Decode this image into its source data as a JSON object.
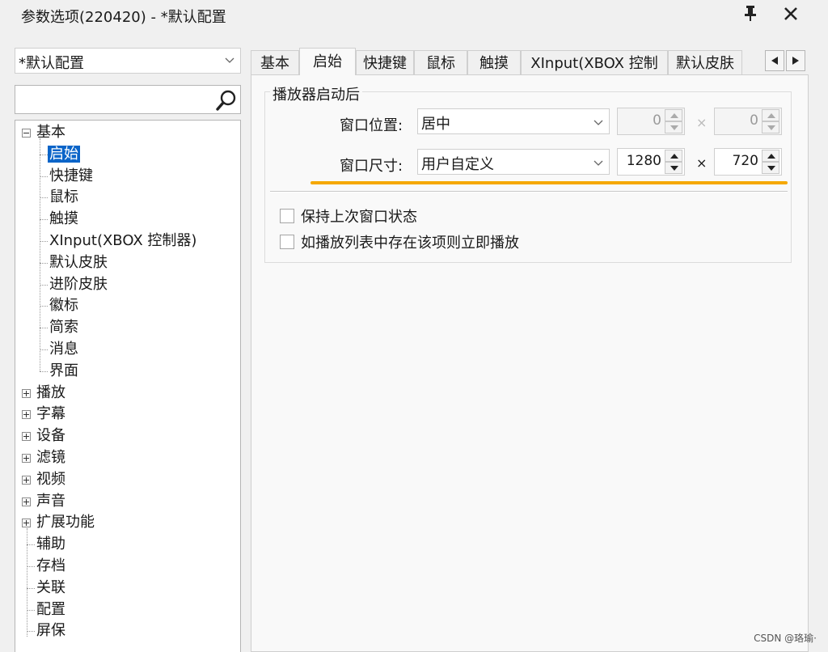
{
  "window": {
    "title": "参数选项(220420) - *默认配置",
    "pin_icon": "pin-icon",
    "close_icon": "close-icon"
  },
  "left": {
    "profile": "*默认配置",
    "search_placeholder": ""
  },
  "tree": {
    "items": [
      {
        "label": "基本",
        "level": 0,
        "expander": "minus"
      },
      {
        "label": "启始",
        "level": 1,
        "selected": true
      },
      {
        "label": "快捷键",
        "level": 1
      },
      {
        "label": "鼠标",
        "level": 1
      },
      {
        "label": "触摸",
        "level": 1
      },
      {
        "label": "XInput(XBOX 控制器)",
        "level": 1
      },
      {
        "label": "默认皮肤",
        "level": 1
      },
      {
        "label": "进阶皮肤",
        "level": 1
      },
      {
        "label": "徽标",
        "level": 1
      },
      {
        "label": "简索",
        "level": 1
      },
      {
        "label": "消息",
        "level": 1
      },
      {
        "label": "界面",
        "level": 1
      },
      {
        "label": "播放",
        "level": 0,
        "expander": "plus"
      },
      {
        "label": "字幕",
        "level": 0,
        "expander": "plus"
      },
      {
        "label": "设备",
        "level": 0,
        "expander": "plus"
      },
      {
        "label": "滤镜",
        "level": 0,
        "expander": "plus"
      },
      {
        "label": "视频",
        "level": 0,
        "expander": "plus"
      },
      {
        "label": "声音",
        "level": 0,
        "expander": "plus"
      },
      {
        "label": "扩展功能",
        "level": 0,
        "expander": "plus"
      },
      {
        "label": "辅助",
        "level": 0
      },
      {
        "label": "存档",
        "level": 0
      },
      {
        "label": "关联",
        "level": 0
      },
      {
        "label": "配置",
        "level": 0
      },
      {
        "label": "屏保",
        "level": 0
      }
    ]
  },
  "tabs": {
    "items": [
      "基本",
      "启始",
      "快捷键",
      "鼠标",
      "触摸",
      "XInput(XBOX 控制器)",
      "默认皮肤"
    ],
    "active": "启始",
    "scroll_left_icon": "triangle-left-icon",
    "scroll_right_icon": "triangle-right-icon"
  },
  "startup": {
    "group_title": "播放器启动后",
    "position": {
      "label": "窗口位置:",
      "mode": "居中",
      "x": "0",
      "sep": "×",
      "y": "0"
    },
    "size": {
      "label": "窗口尺寸:",
      "mode": "用户自定义",
      "w": "1280",
      "sep": "×",
      "h": "720"
    },
    "checkboxes": [
      {
        "label": "保持上次窗口状态",
        "checked": false
      },
      {
        "label": "如播放列表中存在该项则立即播放",
        "checked": false
      }
    ]
  },
  "colors": {
    "selection": "#0a64c8",
    "highlight": "#f5a800"
  },
  "watermark": "CSDN @珞瑜·"
}
